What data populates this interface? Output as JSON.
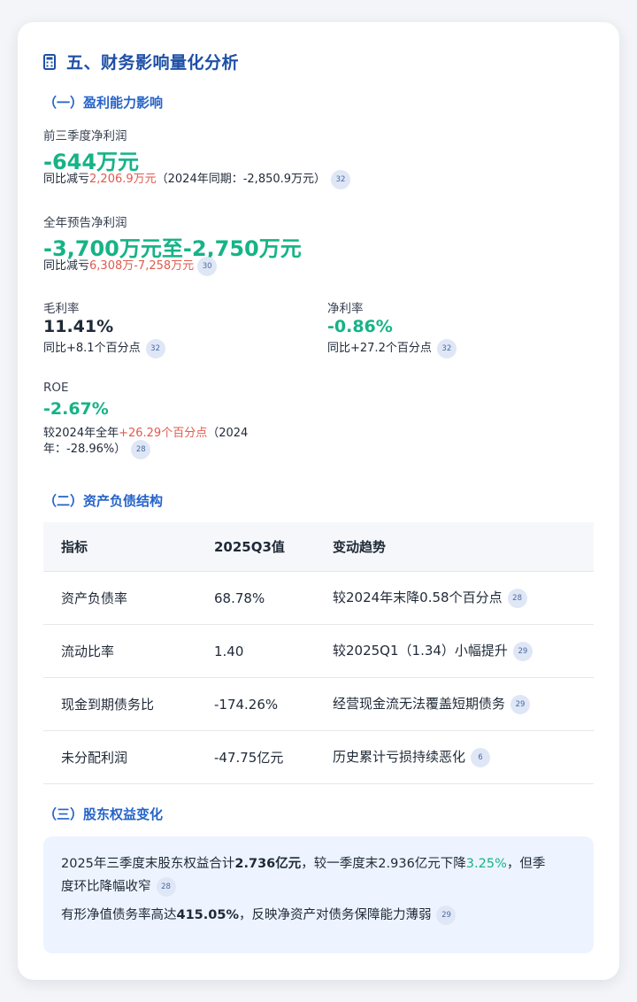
{
  "header": {
    "title": "五、财务影响量化分析",
    "icon": "calculator-icon"
  },
  "profitability": {
    "heading": "（一）盈利能力影响",
    "q3_net_profit": {
      "label": "前三季度净利润",
      "value": "-644万元",
      "note_prefix": "同比减亏",
      "note_highlight": "2,206.9万元",
      "note_suffix": "（2024年同期：-2,850.9万元）",
      "cite": "32"
    },
    "full_year": {
      "label": "全年预告净利润",
      "value": "-3,700万元至-2,750万元",
      "note_prefix": "同比减亏",
      "note_highlight": "6,308万-7,258万元",
      "cite": "30"
    },
    "gross_margin": {
      "label": "毛利率",
      "value": "11.41%",
      "note": "同比+8.1个百分点",
      "cite": "32"
    },
    "net_margin": {
      "label": "净利率",
      "value": "-0.86%",
      "note": "同比+27.2个百分点",
      "cite": "32"
    },
    "roe": {
      "label": "ROE",
      "value": "-2.67%",
      "note_prefix": "较2024年全年",
      "note_highlight": "+26.29个百分点",
      "note_suffix1": "（2024",
      "note_suffix2": "年：-28.96%）",
      "cite": "28"
    }
  },
  "balance": {
    "heading": "（二）资产负债结构",
    "columns": [
      "指标",
      "2025Q3值",
      "变动趋势"
    ],
    "rows": [
      {
        "metric": "资产负债率",
        "value": "68.78%",
        "trend": "较2024年末降0.58个百分点",
        "cite": "28"
      },
      {
        "metric": "流动比率",
        "value": "1.40",
        "trend": "较2025Q1（1.34）小幅提升",
        "cite": "29"
      },
      {
        "metric": "现金到期债务比",
        "value": "-174.26%",
        "trend": "经营现金流无法覆盖短期债务",
        "cite": "29"
      },
      {
        "metric": "未分配利润",
        "value": "-47.75亿元",
        "trend": "历史累计亏损持续恶化",
        "cite": "6"
      }
    ]
  },
  "equity": {
    "heading": "（三）股东权益变化",
    "p1": {
      "t1": "2025年三季度末股东权益合计",
      "b1": "2.736亿元",
      "t2": "，较一季度末2.936亿元下降",
      "g1": "3.25%",
      "t3": "，但季",
      "t4": "度环比降幅收窄",
      "cite": "28"
    },
    "p2": {
      "t1": "有形净值债务率高达",
      "b1": "415.05%",
      "t2": "，反映净资产对债务保障能力薄弱",
      "cite": "29"
    }
  },
  "colors": {
    "accent": "#1e4fa6",
    "positive": "#16b386",
    "highlight_red": "#e05a4f",
    "cite_bg": "#dfe7f6"
  }
}
